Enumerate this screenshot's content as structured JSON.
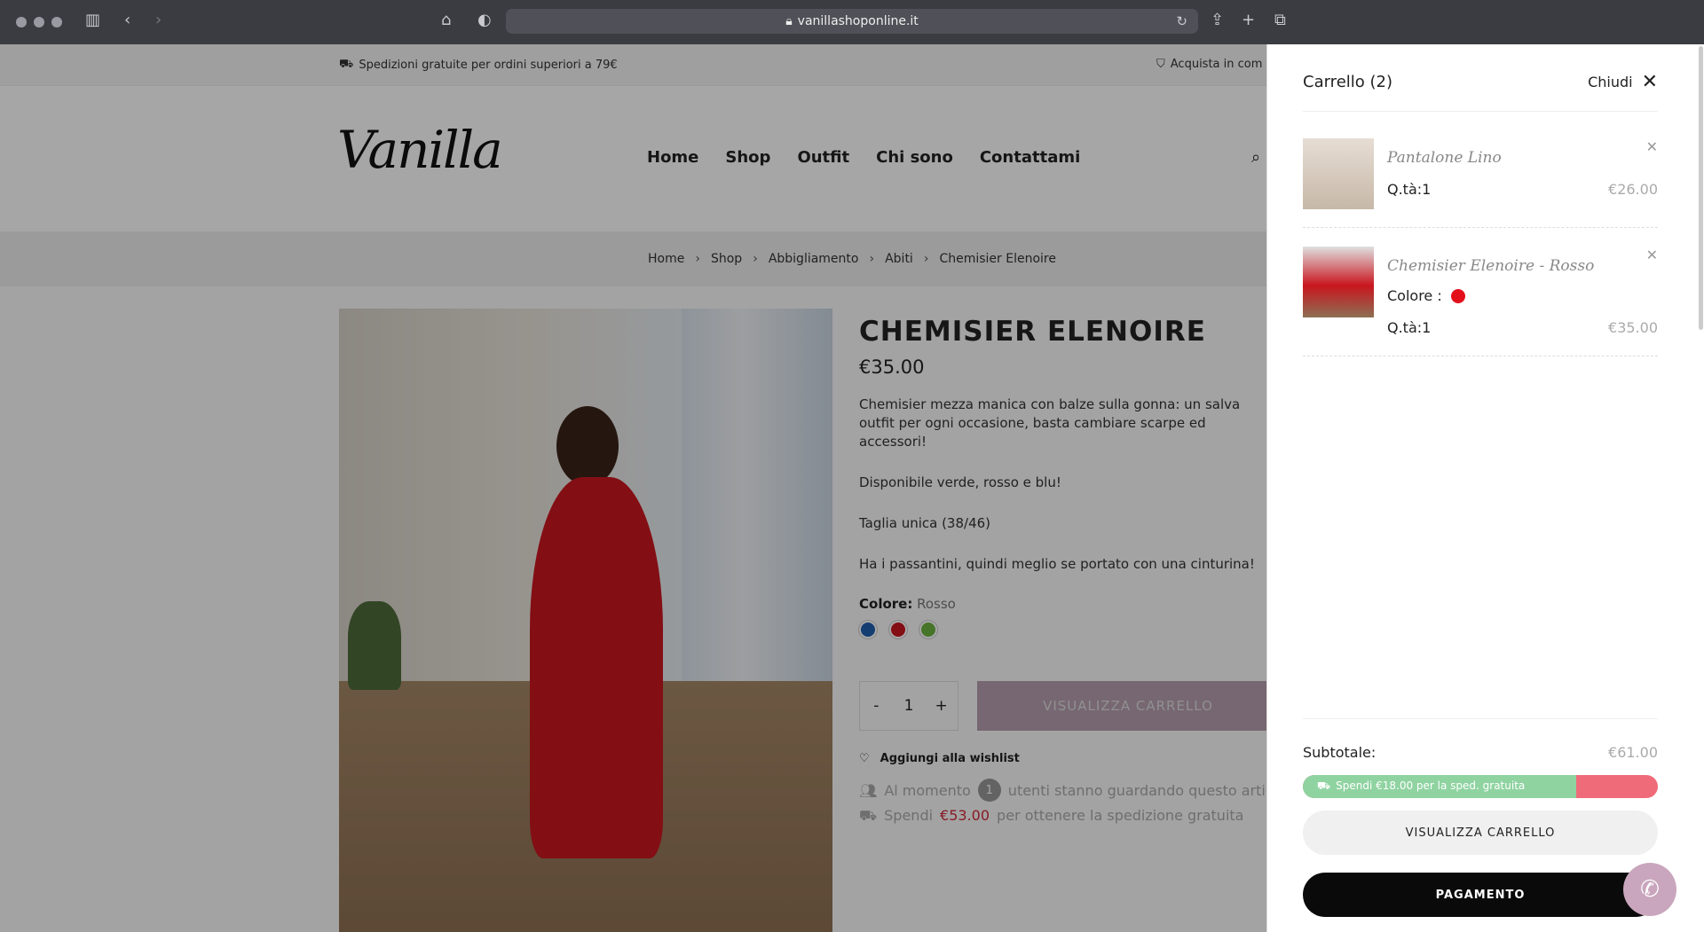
{
  "browser": {
    "url": "vanillashoponline.it",
    "icons": [
      "sidebar-icon",
      "back-icon",
      "forward-icon",
      "home-icon",
      "shield-icon",
      "lock-icon",
      "reload-icon",
      "share-icon",
      "new-tab-icon",
      "tabs-icon"
    ]
  },
  "topbar": {
    "shipping": "Spedizioni gratuite per ordini superiori a 79€",
    "secure": "Acquista in com"
  },
  "header": {
    "logo": "Vanilla",
    "nav": [
      "Home",
      "Shop",
      "Outfit",
      "Chi sono",
      "Contattami"
    ]
  },
  "breadcrumb": [
    "Home",
    "Shop",
    "Abbigliamento",
    "Abiti",
    "Chemisier Elenoire"
  ],
  "product": {
    "title": "CHEMISIER ELENOIRE",
    "price": "€35.00",
    "description": [
      "Chemisier mezza manica con balze sulla gonna: un salva outfit per ogni occasione, basta cambiare scarpe ed accessori!",
      "Disponibile verde, rosso e blu!",
      "Taglia unica (38/46)",
      "Ha i passantini, quindi meglio se portato con una cinturina!"
    ],
    "color_label": "Colore:",
    "color_value": "Rosso",
    "swatches": [
      "#1f5fb0",
      "#c9161f",
      "#6cb33f"
    ],
    "qty_minus": "-",
    "qty": "1",
    "qty_plus": "+",
    "add_button": "VISUALIZZA CARRELLO",
    "wishlist": "Aggiungi alla wishlist",
    "watching_pre": "Al momento",
    "watching_count": "1",
    "watching_post": "utenti stanno guardando questo arti",
    "spend_pre": "Spendi",
    "spend_amount": "€53.00",
    "spend_post": "per ottenere la spedizione gratuita"
  },
  "cart": {
    "title": "Carrello (2)",
    "close": "Chiudi",
    "items": [
      {
        "name": "Pantalone Lino",
        "qty": "Q.tà:1",
        "price": "€26.00"
      },
      {
        "name": "Chemisier Elenoire - Rosso",
        "color_label": "Colore :",
        "color": "#e3101b",
        "qty": "Q.tà:1",
        "price": "€35.00"
      }
    ],
    "subtotal_label": "Subtotale:",
    "subtotal": "€61.00",
    "shipping_progress_text": "Spendi €18.00 per la sped. gratuita",
    "shipping_progress": 0.77,
    "view_cart": "VISUALIZZA CARRELLO",
    "checkout": "PAGAMENTO"
  }
}
